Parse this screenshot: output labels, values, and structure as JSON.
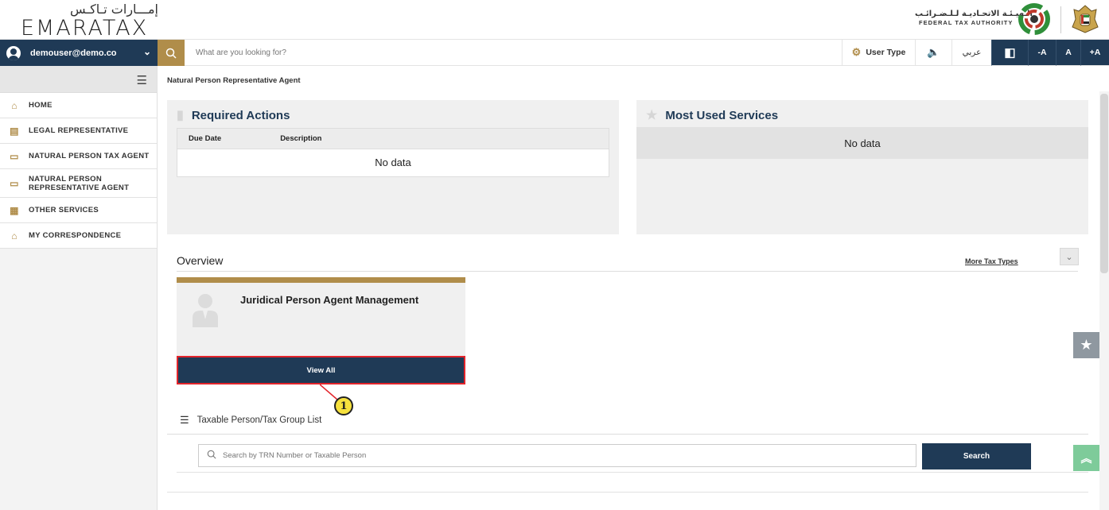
{
  "header": {
    "logo_ar": "إمـــارات تـاكـس",
    "logo_en": "EMARATAX",
    "fta_ar": "الـهيـئـة الاتحـاديـة لـلـضـرائـب",
    "fta_en": "FEDERAL TAX AUTHORITY"
  },
  "toolbar": {
    "user": "demouser@demo.co",
    "search_placeholder": "What are you looking for?",
    "user_type": "User Type",
    "speaker": "🔈",
    "arabic": "عربي",
    "contrast": "◧",
    "font_minus": "-A",
    "font_normal": "A",
    "font_plus": "+A"
  },
  "sidebar": {
    "items": [
      {
        "label": "HOME",
        "icon": "home-icon"
      },
      {
        "label": "LEGAL REPRESENTATIVE",
        "icon": "legal-rep-icon"
      },
      {
        "label": "NATURAL PERSON TAX AGENT",
        "icon": "id-card-icon"
      },
      {
        "label": "NATURAL PERSON REPRESENTATIVE AGENT",
        "icon": "id-card-icon"
      },
      {
        "label": "OTHER SERVICES",
        "icon": "clipboard-icon"
      },
      {
        "label": "MY CORRESPONDENCE",
        "icon": "building-icon"
      }
    ]
  },
  "breadcrumb": "Natural Person Representative Agent",
  "required_actions": {
    "title": "Required Actions",
    "col_due": "Due Date",
    "col_desc": "Description",
    "empty": "No data"
  },
  "most_used": {
    "title": "Most Used Services",
    "empty": "No data"
  },
  "overview": {
    "title": "Overview",
    "more_tax": "More Tax Types",
    "card_title": "Juridical Person Agent Management",
    "view_all": "View All",
    "callout": "1"
  },
  "taxable": {
    "title": "Taxable Person/Tax Group List",
    "search_placeholder": "Search by TRN Number or Taxable Person",
    "search_button": "Search"
  },
  "colors": {
    "navy": "#1f3a56",
    "gold": "#b08d4a",
    "highlight": "#e3242b"
  }
}
